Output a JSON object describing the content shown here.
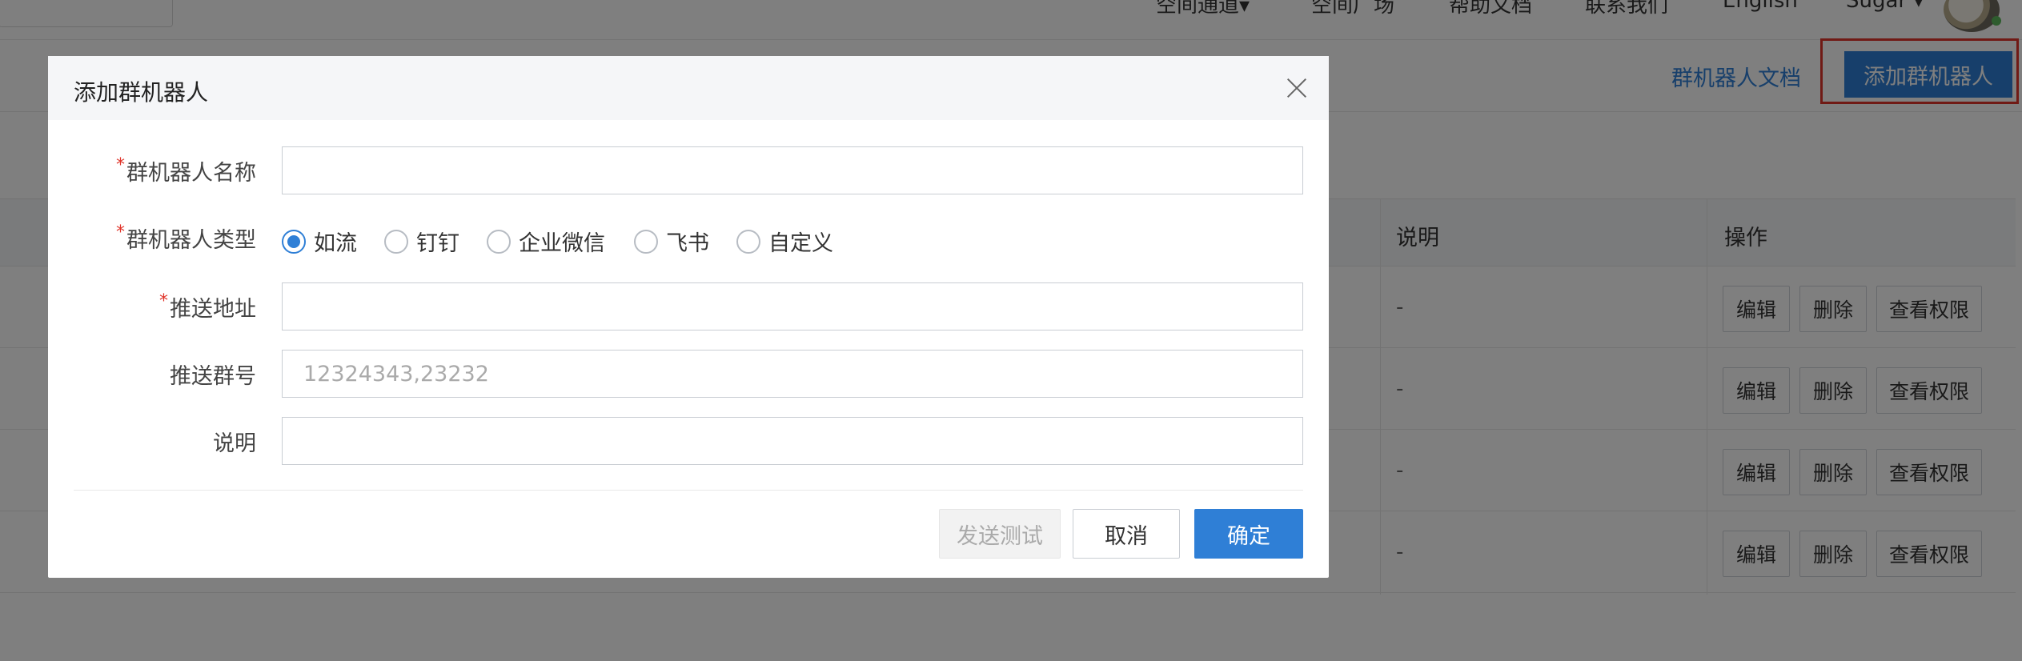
{
  "topnav": {
    "items": [
      "空间通道▾",
      "空间广场",
      "帮助文档",
      "联系我们",
      "English",
      "Sugar ▾"
    ]
  },
  "header": {
    "doc_link": "群机器人文档",
    "add_button": "添加群机器人"
  },
  "table": {
    "headers": {
      "desc": "说明",
      "ops": "操作"
    },
    "rows": [
      {
        "desc": "-",
        "edit": "编辑",
        "delete": "删除",
        "perm": "查看权限"
      },
      {
        "desc": "-",
        "edit": "编辑",
        "delete": "删除",
        "perm": "查看权限"
      },
      {
        "desc": "-",
        "edit": "编辑",
        "delete": "删除",
        "perm": "查看权限"
      },
      {
        "desc": "-",
        "edit": "编辑",
        "delete": "删除",
        "perm": "查看权限"
      }
    ]
  },
  "modal": {
    "title": "添加群机器人",
    "fields": {
      "name_label": "群机器人名称",
      "type_label": "群机器人类型",
      "url_label": "推送地址",
      "group_label": "推送群号",
      "group_placeholder": "12324343,23232",
      "desc_label": "说明"
    },
    "types": [
      "如流",
      "钉钉",
      "企业微信",
      "飞书",
      "自定义"
    ],
    "selected_type": "如流",
    "buttons": {
      "test": "发送测试",
      "cancel": "取消",
      "ok": "确定"
    }
  },
  "colors": {
    "accent": "#2f7fd6",
    "required": "#e0342a",
    "highlight_frame": "#e0342a"
  }
}
